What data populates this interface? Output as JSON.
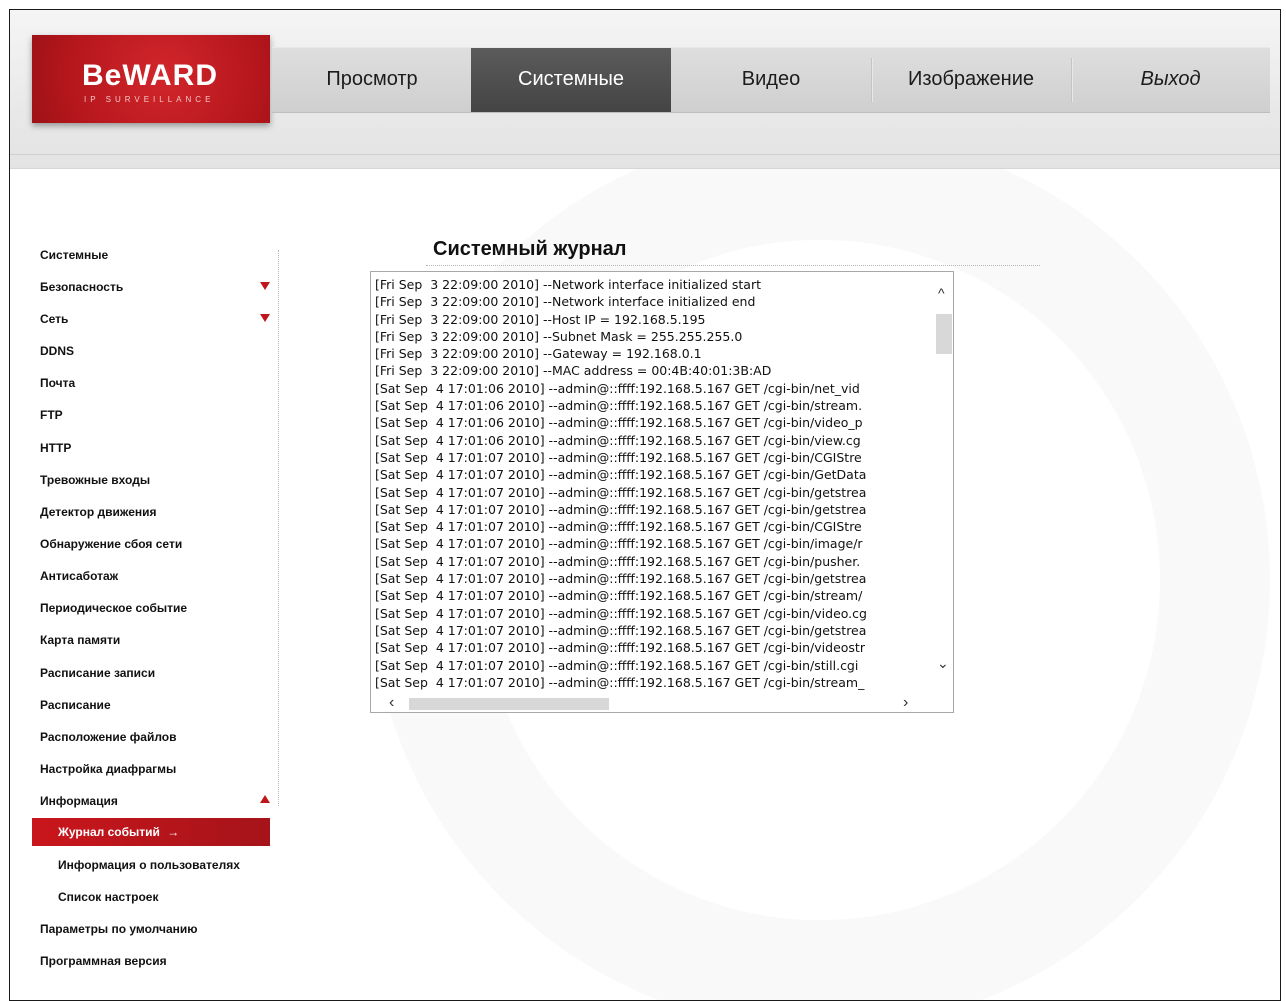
{
  "brand": {
    "logo_text": "BeWARD",
    "logo_sub": "IP SURVEILLANCE"
  },
  "nav": {
    "items": [
      {
        "label": "Просмотр"
      },
      {
        "label": "Системные",
        "active": true
      },
      {
        "label": "Видео"
      },
      {
        "label": "Изображение"
      },
      {
        "label": "Выход"
      }
    ]
  },
  "sidebar": {
    "items": [
      {
        "label": "Системные"
      },
      {
        "label": "Безопасность",
        "arrow": "down"
      },
      {
        "label": "Сеть",
        "arrow": "down"
      },
      {
        "label": "DDNS"
      },
      {
        "label": "Почта"
      },
      {
        "label": "FTP"
      },
      {
        "label": "HTTP"
      },
      {
        "label": "Тревожные входы"
      },
      {
        "label": "Детектор движения"
      },
      {
        "label": "Обнаружение сбоя сети"
      },
      {
        "label": "Антисаботаж"
      },
      {
        "label": "Периодическое событие"
      },
      {
        "label": "Карта памяти"
      },
      {
        "label": "Расписание записи"
      },
      {
        "label": "Расписание"
      },
      {
        "label": "Расположение файлов"
      },
      {
        "label": "Настройка диафрагмы"
      },
      {
        "label": "Информация",
        "arrow": "up"
      }
    ],
    "sub_items": [
      {
        "label": "Журнал событий",
        "active": true
      },
      {
        "label": "Информация о пользователях"
      },
      {
        "label": "Список настроек"
      }
    ],
    "bottom_items": [
      {
        "label": "Параметры по умолчанию"
      },
      {
        "label": "Программная версия"
      }
    ],
    "active_arrow": "→"
  },
  "main": {
    "title": "Системный журнал",
    "log_lines": [
      "[Fri Sep  3 22:09:00 2010] --Network interface initialized start",
      "[Fri Sep  3 22:09:00 2010] --Network interface initialized end",
      "[Fri Sep  3 22:09:00 2010] --Host IP = 192.168.5.195",
      "[Fri Sep  3 22:09:00 2010] --Subnet Mask = 255.255.255.0",
      "[Fri Sep  3 22:09:00 2010] --Gateway = 192.168.0.1",
      "[Fri Sep  3 22:09:00 2010] --MAC address = 00:4B:40:01:3B:AD",
      "[Sat Sep  4 17:01:06 2010] --admin@::ffff:192.168.5.167 GET /cgi-bin/net_vid",
      "[Sat Sep  4 17:01:06 2010] --admin@::ffff:192.168.5.167 GET /cgi-bin/stream.",
      "[Sat Sep  4 17:01:06 2010] --admin@::ffff:192.168.5.167 GET /cgi-bin/video_p",
      "[Sat Sep  4 17:01:06 2010] --admin@::ffff:192.168.5.167 GET /cgi-bin/view.cg",
      "[Sat Sep  4 17:01:07 2010] --admin@::ffff:192.168.5.167 GET /cgi-bin/CGIStre",
      "[Sat Sep  4 17:01:07 2010] --admin@::ffff:192.168.5.167 GET /cgi-bin/GetData",
      "[Sat Sep  4 17:01:07 2010] --admin@::ffff:192.168.5.167 GET /cgi-bin/getstrea",
      "[Sat Sep  4 17:01:07 2010] --admin@::ffff:192.168.5.167 GET /cgi-bin/getstrea",
      "[Sat Sep  4 17:01:07 2010] --admin@::ffff:192.168.5.167 GET /cgi-bin/CGIStre",
      "[Sat Sep  4 17:01:07 2010] --admin@::ffff:192.168.5.167 GET /cgi-bin/image/r",
      "[Sat Sep  4 17:01:07 2010] --admin@::ffff:192.168.5.167 GET /cgi-bin/pusher.",
      "[Sat Sep  4 17:01:07 2010] --admin@::ffff:192.168.5.167 GET /cgi-bin/getstrea",
      "[Sat Sep  4 17:01:07 2010] --admin@::ffff:192.168.5.167 GET /cgi-bin/stream/",
      "[Sat Sep  4 17:01:07 2010] --admin@::ffff:192.168.5.167 GET /cgi-bin/video.cg",
      "[Sat Sep  4 17:01:07 2010] --admin@::ffff:192.168.5.167 GET /cgi-bin/getstrea",
      "[Sat Sep  4 17:01:07 2010] --admin@::ffff:192.168.5.167 GET /cgi-bin/videostr",
      "[Sat Sep  4 17:01:07 2010] --admin@::ffff:192.168.5.167 GET /cgi-bin/still.cgi",
      "[Sat Sep  4 17:01:07 2010] --admin@::ffff:192.168.5.167 GET /cgi-bin/stream_"
    ]
  },
  "colors": {
    "accent": "#c0151b",
    "nav_active": "#4d4d4d"
  }
}
